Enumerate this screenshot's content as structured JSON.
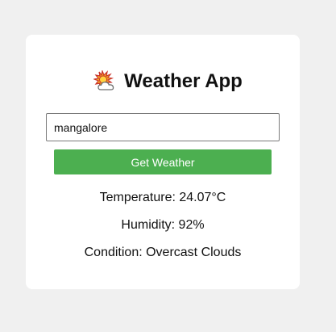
{
  "app": {
    "title": "Weather App",
    "icon": "sun-behind-cloud-icon"
  },
  "search": {
    "value": "mangalore",
    "button_label": "Get Weather"
  },
  "weather": {
    "temperature_label": "Temperature:",
    "temperature_value": "24.07°C",
    "humidity_label": "Humidity:",
    "humidity_value": "92%",
    "condition_label": "Condition:",
    "condition_value": "Overcast Clouds"
  },
  "colors": {
    "button_bg": "#4caf50",
    "page_bg": "#f0f0f0",
    "card_bg": "#ffffff"
  }
}
